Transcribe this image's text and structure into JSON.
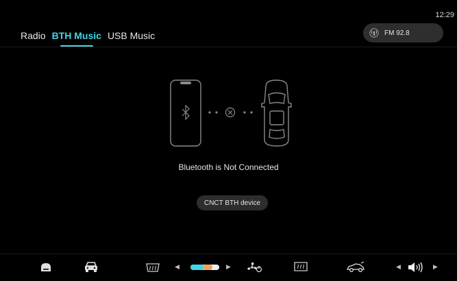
{
  "status_bar": {
    "time": "12:29"
  },
  "tabs": [
    {
      "label": "Radio",
      "active": false
    },
    {
      "label": "BTH Music",
      "active": true
    },
    {
      "label": "USB Music",
      "active": false
    }
  ],
  "radio_widget": {
    "icon": "radio-broadcast-icon",
    "label": "FM 92.8"
  },
  "bluetooth": {
    "status": "Bluetooth is Not Connected",
    "connect_label": "CNCT BTH device"
  },
  "bottom_bar": {
    "items": [
      "home-icon",
      "car-icon",
      "rear-defrost-icon",
      "fan-speed-icon",
      "front-defrost-icon",
      "car-side-icon",
      "volume-icon"
    ],
    "fan_level": 0.5
  },
  "colors": {
    "accent": "#45d4e6",
    "background": "#000000",
    "pill": "#2e2e30"
  }
}
